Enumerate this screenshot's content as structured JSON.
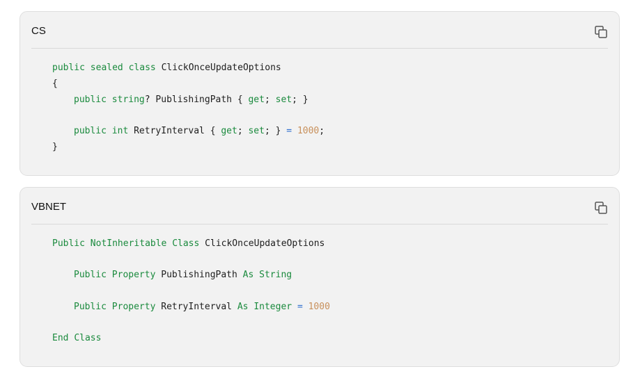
{
  "colors": {
    "keyword": "#1a8a3d",
    "operator": "#2f6fcf",
    "number": "#c8905b",
    "text": "#1e1e1e",
    "panel_background": "#f2f2f2"
  },
  "cs": {
    "language": "CS",
    "copy_icon": "copy-icon",
    "lines": [
      {
        "kw1": "public",
        "kw2": "sealed",
        "kw3": "class",
        "name": "ClickOnceUpdateOptions"
      },
      {
        "text": "{"
      },
      {
        "kw1": "public",
        "kw2": "string",
        "q": "?",
        "name": "PublishingPath",
        "open": "{",
        "get": "get",
        "semi1": ";",
        "set": "set",
        "semi2": ";",
        "close": "}"
      },
      {
        "kw1": "public",
        "kw2": "int",
        "name": "RetryInterval",
        "open": "{",
        "get": "get",
        "semi1": ";",
        "set": "set",
        "semi2": ";",
        "close": "}",
        "eq": "=",
        "num": "1000",
        "end": ";"
      },
      {
        "text": "}"
      }
    ]
  },
  "vb": {
    "language": "VBNET",
    "copy_icon": "copy-icon",
    "lines": [
      {
        "kw1": "Public",
        "kw2": "NotInheritable",
        "kw3": "Class",
        "name": "ClickOnceUpdateOptions"
      },
      {
        "kw1": "Public",
        "kw2": "Property",
        "name": "PublishingPath",
        "as": "As",
        "type": "String"
      },
      {
        "kw1": "Public",
        "kw2": "Property",
        "name": "RetryInterval",
        "as": "As",
        "type": "Integer",
        "eq": "=",
        "num": "1000"
      },
      {
        "kw1": "End",
        "kw2": "Class"
      }
    ]
  }
}
